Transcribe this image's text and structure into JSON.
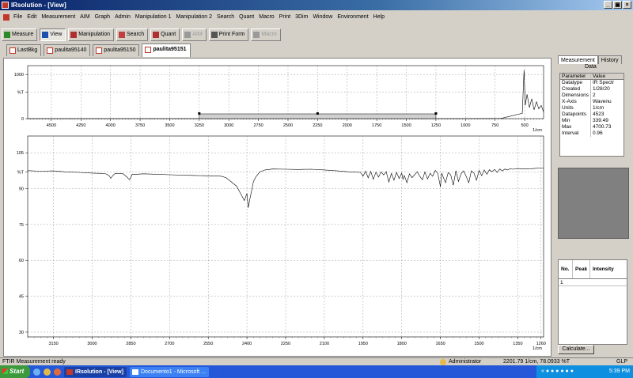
{
  "window": {
    "title": "IRsolution - [View]"
  },
  "menu": [
    "File",
    "Edit",
    "Measurement",
    "AIM",
    "Graph",
    "Admin",
    "Manipulation 1",
    "Manipulation 2",
    "Search",
    "Quant",
    "Macro",
    "Print",
    "3Dim",
    "Window",
    "Environment",
    "Help"
  ],
  "toolbar": [
    {
      "label": "Measure",
      "icon": "measure-icon",
      "state": "normal"
    },
    {
      "label": "View",
      "icon": "eye-icon",
      "state": "pressed"
    },
    {
      "label": "Manipulation",
      "icon": "manipulation-icon",
      "state": "normal"
    },
    {
      "label": "Search",
      "icon": "search-icon",
      "state": "normal"
    },
    {
      "label": "Quant",
      "icon": "quant-icon",
      "state": "normal"
    },
    {
      "label": "AIM",
      "icon": "aim-icon",
      "state": "disabled"
    },
    {
      "label": "Print Form",
      "icon": "printer-icon",
      "state": "normal"
    },
    {
      "label": "Macro",
      "icon": "macro-icon",
      "state": "disabled"
    }
  ],
  "doc_tabs": [
    {
      "label": "LastBkg",
      "active": false
    },
    {
      "label": "paulita95140",
      "active": false
    },
    {
      "label": "paulita95150",
      "active": false
    },
    {
      "label": "paulita95151",
      "active": true
    }
  ],
  "side_panel": {
    "tabs": [
      "Measurement",
      "History"
    ],
    "title": "Data",
    "table_headers": [
      "Parameter",
      "Value"
    ],
    "params": [
      [
        "Datatype",
        "IR Spectr"
      ],
      [
        "Created",
        "1/28/20"
      ],
      [
        "Dimensions",
        "2"
      ],
      [
        "X-Axis",
        "Wavenu"
      ],
      [
        "Units",
        "1/cm"
      ],
      [
        "Datapoints",
        "4523"
      ],
      [
        "Min",
        "339.49"
      ],
      [
        "Max",
        "4700.73"
      ],
      [
        "Interval",
        "0.96"
      ]
    ],
    "peak_headers": [
      "No.",
      "Peak",
      "Intensity"
    ],
    "peak_first_row": "1",
    "calculate_label": "Calculate..."
  },
  "chart_data": [
    {
      "type": "line",
      "name": "overview",
      "xlabel": "1/cm",
      "ylabel": "%T",
      "xlim": [
        4700,
        340
      ],
      "ylim": [
        0,
        1200
      ],
      "x_ticks": [
        4500,
        4250,
        4000,
        3750,
        3500,
        3250,
        3000,
        2750,
        2500,
        2250,
        2000,
        1750,
        1500,
        1250,
        1000,
        750,
        500
      ],
      "y_ticks": [
        {
          "value": 1000,
          "label": "1000"
        },
        {
          "value": 600,
          "label": "%T"
        },
        {
          "value": 0,
          "label": "0"
        }
      ],
      "selection_range": [
        3250,
        1250
      ],
      "series": [
        {
          "x": [
            4700,
            4000,
            3500,
            3000,
            2500,
            2000,
            1500,
            1000,
            700,
            520,
            505,
            495,
            480,
            460,
            440,
            420,
            400,
            380,
            360,
            340
          ],
          "y": [
            0,
            0,
            0,
            0,
            0,
            0,
            0,
            0,
            5,
            120,
            1100,
            300,
            550,
            250,
            450,
            200,
            380,
            220,
            300,
            150
          ]
        }
      ]
    },
    {
      "type": "line",
      "name": "zoom",
      "xlabel": "1/cm",
      "ylabel": "%T",
      "xlim": [
        3250,
        1250
      ],
      "ylim": [
        28,
        112
      ],
      "grid": true,
      "x_ticks": [
        {
          "value": 3150,
          "label": "3150"
        },
        {
          "value": 3000,
          "label": "3000"
        },
        {
          "value": 2850,
          "label": "2850"
        },
        {
          "value": 2700,
          "label": "2700"
        },
        {
          "value": 2550,
          "label": "2550"
        },
        {
          "value": 2400,
          "label": "2400"
        },
        {
          "value": 2250,
          "label": "2250"
        },
        {
          "value": 2100,
          "label": "2100"
        },
        {
          "value": 1950,
          "label": "1950"
        },
        {
          "value": 1800,
          "label": "1800"
        },
        {
          "value": 1650,
          "label": "1650"
        },
        {
          "value": 1500,
          "label": "1500"
        },
        {
          "value": 1350,
          "label": "1350"
        },
        {
          "value": 1260,
          "label": "1260"
        }
      ],
      "y_ticks": [
        {
          "value": 105,
          "label": "105"
        },
        {
          "value": 97,
          "label": "%T"
        },
        {
          "value": 90,
          "label": "90"
        },
        {
          "value": 75,
          "label": "75"
        },
        {
          "value": 60,
          "label": "60"
        },
        {
          "value": 45,
          "label": "45"
        },
        {
          "value": 30,
          "label": "30"
        }
      ],
      "series": [
        {
          "x": [
            3250,
            3200,
            3150,
            3100,
            3050,
            3000,
            2950,
            2935,
            2928,
            2920,
            2910,
            2880,
            2865,
            2855,
            2845,
            2800,
            2700,
            2600,
            2500,
            2480,
            2440,
            2420,
            2410,
            2400,
            2395,
            2388,
            2380,
            2375,
            2365,
            2350,
            2330,
            2300,
            2250,
            2200,
            2150,
            2100,
            2050,
            2000,
            1960,
            1950,
            1940,
            1930,
            1920,
            1910,
            1900,
            1890,
            1880,
            1870,
            1860,
            1850,
            1840,
            1830,
            1820,
            1810,
            1800,
            1795,
            1790,
            1780,
            1770,
            1760,
            1750,
            1740,
            1730,
            1720,
            1710,
            1700,
            1690,
            1680,
            1670,
            1660,
            1650,
            1645,
            1640,
            1630,
            1620,
            1610,
            1600,
            1590,
            1580,
            1570,
            1560,
            1550,
            1540,
            1530,
            1520,
            1510,
            1500,
            1490,
            1480,
            1470,
            1460,
            1450,
            1440,
            1430,
            1420,
            1410,
            1400,
            1390,
            1380,
            1370,
            1350,
            1320,
            1300,
            1280,
            1260,
            1250
          ],
          "y": [
            97.5,
            97.3,
            97.4,
            97,
            96.8,
            96.5,
            96.3,
            95.5,
            94.3,
            95.5,
            96.4,
            96.2,
            94.8,
            93.7,
            95.9,
            96.2,
            95.8,
            95.5,
            95.2,
            94.5,
            91,
            87,
            85,
            88,
            82,
            86,
            90,
            93,
            95,
            97,
            97.8,
            98.2,
            98.1,
            98,
            98.1,
            97.8,
            97.4,
            97,
            96.8,
            95.2,
            97.3,
            94.5,
            97.2,
            93.9,
            96.9,
            94.8,
            97,
            95.7,
            97.1,
            92.8,
            96.4,
            93.5,
            96.8,
            94.2,
            96.5,
            93.9,
            95.5,
            92.5,
            96.2,
            94.6,
            95.8,
            97.1,
            95.2,
            93.7,
            97,
            94,
            96.4,
            95.2,
            97.6,
            96.3,
            90.8,
            96.5,
            95,
            92.5,
            96.7,
            95.8,
            91.4,
            97.5,
            93,
            96.2,
            97.4,
            95.1,
            92.5,
            97.4,
            96.5,
            93.5,
            97.6,
            95.4,
            97.8,
            96,
            97.9,
            97.1,
            98,
            96.8,
            98.2,
            97.4,
            98.2,
            97.8,
            98.3,
            98.1,
            98.4,
            98.2,
            98.3,
            98.5,
            98.6,
            98.6
          ]
        }
      ]
    }
  ],
  "status": {
    "left": "FTIR Measurement ready",
    "user": "Administrator",
    "readout": "2201.79 1/cm, 78.0933 %T",
    "mode": "GLP"
  },
  "taskbar": {
    "start": "Start",
    "tasks": [
      {
        "label": "IRsolution - [View]",
        "active": true
      },
      {
        "label": "Documento1 - Microsoft ...",
        "active": false
      }
    ],
    "clock": "5:39 PM"
  }
}
